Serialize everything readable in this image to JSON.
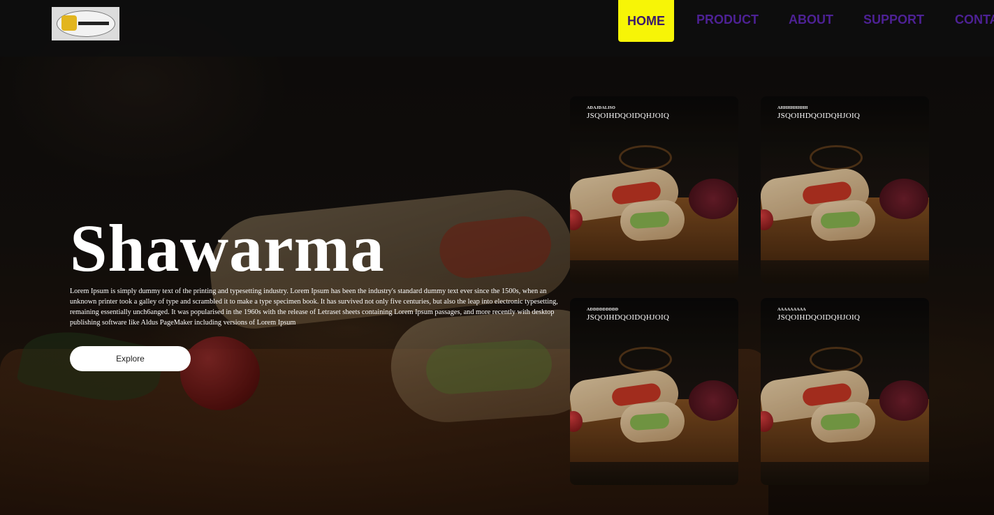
{
  "nav": {
    "logo_name": "brand-logo",
    "home": "HOME",
    "links": [
      "PRODUCT",
      "ABOUT",
      "SUPPORT",
      "CONTA"
    ],
    "active_color": "#f7f506",
    "link_color": "#4d2194"
  },
  "hero": {
    "title": "Shawarma",
    "description": "Lorem Ipsum is simply dummy text of the printing and typesetting industry. Lorem Ipsum has been the industry's standard dummy text ever since the 1500s, when an unknown printer took a galley of type and scrambled it to make a type specimen book. It has survived not only five centuries, but also the leap into electronic typesetting, remaining essentially unch6anged. It was popularised in the 1960s with the release of Letraset sheets containing Lorem Ipsum passages, and more recently with desktop publishing software like Aldus PageMaker including versions of Lorem Ipsum",
    "button": "Explore"
  },
  "cards": [
    {
      "tag": "ADAJDALISO",
      "title": "JSQOIHDQOIDQHJOIQ"
    },
    {
      "tag": "AHHHHHHHH",
      "title": "JSQOIHDQOIDQHJOIQ"
    },
    {
      "tag": "ADDDDDDDDD",
      "title": "JSQOIHDQOIDQHJOIQ"
    },
    {
      "tag": "AAAAAAAAA",
      "title": "JSQOIHDQOIDQHJOIQ"
    }
  ]
}
